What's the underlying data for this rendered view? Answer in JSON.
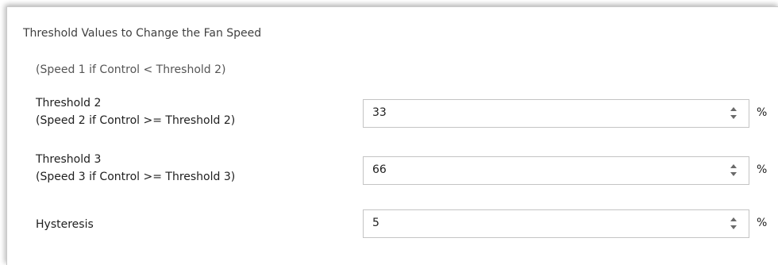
{
  "title": "Threshold Values to Change the Fan Speed",
  "note": "(Speed 1 if Control < Threshold 2)",
  "rows": [
    {
      "label_line1": "Threshold 2",
      "label_line2": "(Speed 2 if Control >= Threshold 2)",
      "value": "33",
      "unit": "%"
    },
    {
      "label_line1": "Threshold 3",
      "label_line2": "(Speed 3 if Control >= Threshold 3)",
      "value": "66",
      "unit": "%"
    },
    {
      "label_line1": "Hysteresis",
      "value": "5",
      "unit": "%"
    }
  ]
}
